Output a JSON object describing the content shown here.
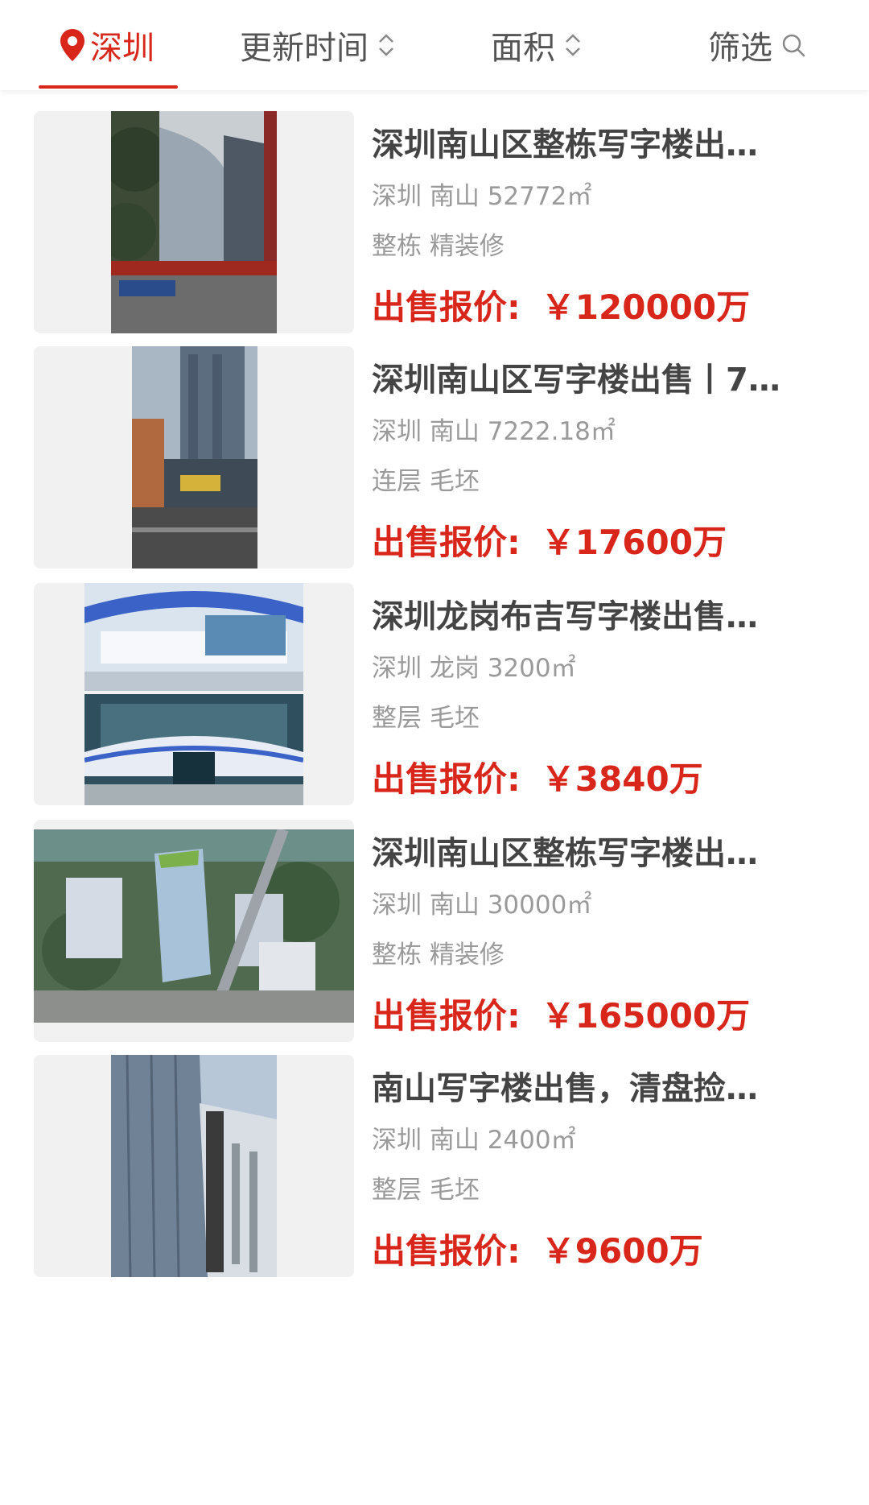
{
  "filters": {
    "city": "深圳",
    "update_time": "更新时间",
    "area": "面积",
    "filter": "筛选"
  },
  "colors": {
    "accent": "#d8261b",
    "title": "#444444",
    "muted": "#9a9a9a"
  },
  "listings": [
    {
      "title": "深圳南山区整栋写字楼出…",
      "location": "深圳 南山 52772㎡",
      "tags": "整栋 精装修",
      "price_label": "出售报价:",
      "price": "￥120000万"
    },
    {
      "title": "深圳南山区写字楼出售丨7…",
      "location": "深圳 南山 7222.18㎡",
      "tags": "连层 毛坯",
      "price_label": "出售报价:",
      "price": "￥17600万"
    },
    {
      "title": "深圳龙岗布吉写字楼出售…",
      "location": "深圳 龙岗 3200㎡",
      "tags": "整层 毛坯",
      "price_label": "出售报价:",
      "price": "￥3840万"
    },
    {
      "title": "深圳南山区整栋写字楼出…",
      "location": "深圳 南山 30000㎡",
      "tags": "整栋 精装修",
      "price_label": "出售报价:",
      "price": "￥165000万"
    },
    {
      "title": "南山写字楼出售，清盘捡…",
      "location": "深圳 南山 2400㎡",
      "tags": "整层 毛坯",
      "price_label": "出售报价:",
      "price": "￥9600万"
    }
  ]
}
